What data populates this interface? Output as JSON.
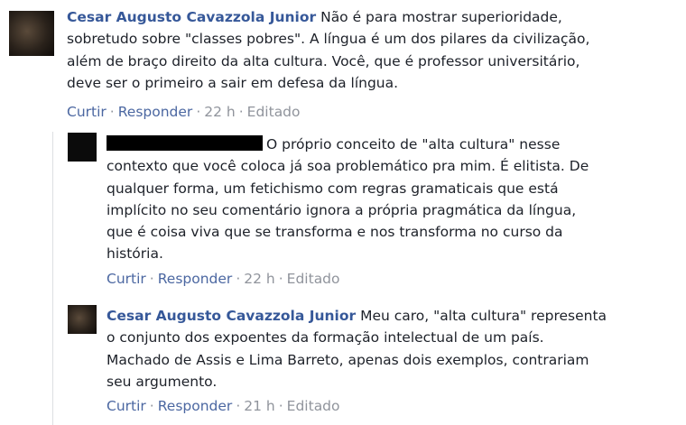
{
  "comments": [
    {
      "author": "Cesar Augusto Cavazzola Junior",
      "lines": [
        "Não é para mostrar superioridade,",
        "sobretudo sobre \"classes pobres\". A língua é um dos pilares da civilização,",
        "além de braço direito da alta cultura. Você, que é professor universitário,",
        "deve ser o primeiro a sair em defesa da língua."
      ],
      "actions": {
        "like": "Curtir",
        "reply": "Responder",
        "time": "22 h",
        "edited": "Editado"
      }
    },
    {
      "author": "",
      "lines": [
        "O próprio conceito de \"alta cultura\" nesse",
        "contexto que você coloca já soa problemático pra mim. É elitista. De",
        "qualquer forma, um fetichismo com regras gramaticais que está",
        "implícito no seu comentário ignora a própria pragmática da língua,",
        "que é coisa viva que se transforma e nos transforma no curso da",
        "história."
      ],
      "actions": {
        "like": "Curtir",
        "reply": "Responder",
        "time": "22 h",
        "edited": "Editado"
      }
    },
    {
      "author": "Cesar Augusto Cavazzola Junior",
      "lines": [
        "Meu caro, \"alta cultura\" representa",
        "o conjunto dos expoentes da formação intelectual de um país.",
        "Machado de Assis e Lima Barreto, apenas dois exemplos, contrariam",
        "seu argumento."
      ],
      "actions": {
        "like": "Curtir",
        "reply": "Responder",
        "time": "21 h",
        "edited": "Editado"
      }
    }
  ]
}
